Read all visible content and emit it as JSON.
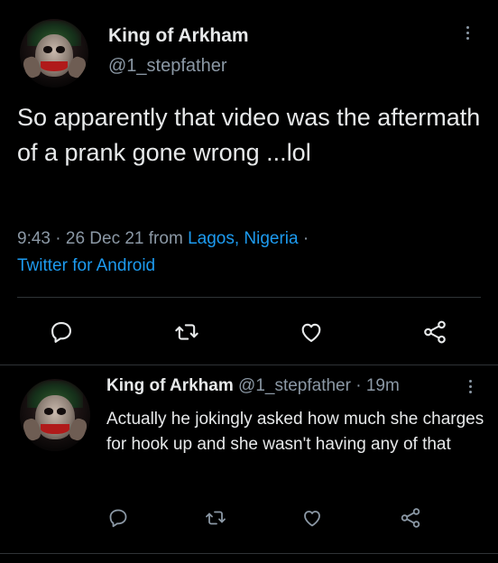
{
  "tweet": {
    "author_name": "King of Arkham",
    "author_handle": "@1_stepfather",
    "text": "So apparently that video was the aftermath of a prank gone wrong ...lol",
    "time": "9:43",
    "dot1": " · ",
    "date": "26 Dec 21",
    "from_label": " from ",
    "location": "Lagos, Nigeria",
    "dot2": " · ",
    "source": "Twitter for Android"
  },
  "reply": {
    "author_name": "King of Arkham",
    "author_handle": "@1_stepfather",
    "separator": " · ",
    "age": "19m",
    "text": "Actually he jokingly asked how much she charges for hook up and she wasn't having any of that"
  },
  "icons": {
    "reply": "reply-icon",
    "retweet": "retweet-icon",
    "like": "heart-icon",
    "share": "share-icon",
    "more": "more-icon"
  },
  "colors": {
    "background": "#000000",
    "text": "#e7e9ea",
    "secondary": "#8b98a5",
    "link": "#1d9bf0",
    "divider": "#2f3336"
  }
}
